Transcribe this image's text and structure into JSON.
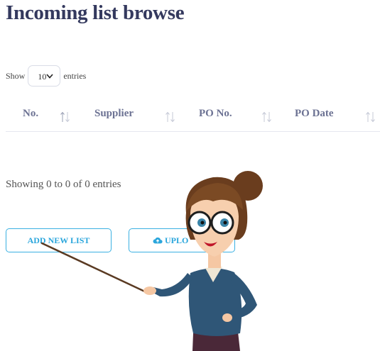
{
  "page": {
    "title": "Incoming list browse"
  },
  "length_menu": {
    "show_label": "Show",
    "selected_value": "10",
    "entries_label": "entries"
  },
  "table": {
    "columns": [
      "No.",
      "Supplier",
      "PO No.",
      "PO Date"
    ],
    "rows": []
  },
  "info": {
    "text": "Showing 0 to 0 of 0 entries"
  },
  "buttons": {
    "add_new_list": "ADD NEW LIST",
    "upload": "UPLO"
  },
  "colors": {
    "heading": "#34395e",
    "accent": "#2ba6dc",
    "header_text": "#6c7293"
  },
  "icons": {
    "length_select": "chevron-down-icon",
    "sort": "sort-arrows-icon",
    "upload": "cloud-upload-icon"
  },
  "illustration": {
    "subject": "teacher-with-pointer"
  }
}
